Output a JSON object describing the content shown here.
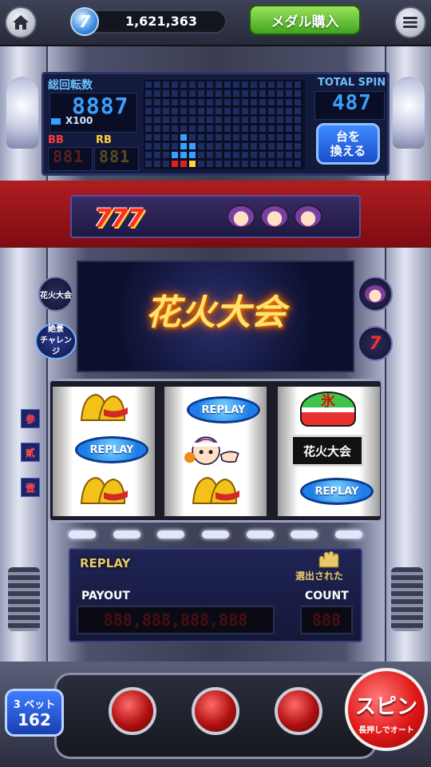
{
  "header": {
    "coin_icon_glyph": "7",
    "coin_balance": "1,621,363",
    "buy_medal_label": "メダル購入",
    "home_icon": "home-icon",
    "menu_icon": "menu-icon"
  },
  "top_panel": {
    "total_rotations_label": "総回転数",
    "total_rotations_value": "8887",
    "x100_label": "X100",
    "bb_label": "BB",
    "bb_value": "881",
    "rb_label": "RB",
    "rb_value": "881",
    "total_spin_label": "TOTAL SPIN",
    "total_spin_value": "487",
    "change_machine_label_1": "台を",
    "change_machine_label_2": "換える"
  },
  "banner": {
    "sevens": "777"
  },
  "display": {
    "title": "花火大会",
    "left_icon_label": "花火大会",
    "zekkei_label_1": "絶景",
    "zekkei_label_2": "チャレンジ",
    "right_icon_2": "7"
  },
  "reel_markers": [
    "参",
    "貳",
    "壹"
  ],
  "reels": {
    "left": [
      "bell",
      "REPLAY",
      "bell"
    ],
    "center": [
      "REPLAY",
      "character",
      "bell"
    ],
    "right": [
      "氷",
      "花火大会",
      "REPLAY"
    ]
  },
  "bottom_panel": {
    "replay_lamp": "REPLAY",
    "selected_label": "選出された",
    "payout_label": "PAYOUT",
    "payout_value": "888,888,888,888",
    "count_label": "COUNT",
    "count_value": "888"
  },
  "controls": {
    "bet_label": "3 ベット",
    "bet_value": "162",
    "spin_label": "スピン",
    "spin_sub": "長押しでオート"
  },
  "colors": {
    "accent_blue": "#39a0ff",
    "buy_green": "#3fa51f",
    "spin_red": "#e01818",
    "panel_navy": "#141a3c"
  }
}
